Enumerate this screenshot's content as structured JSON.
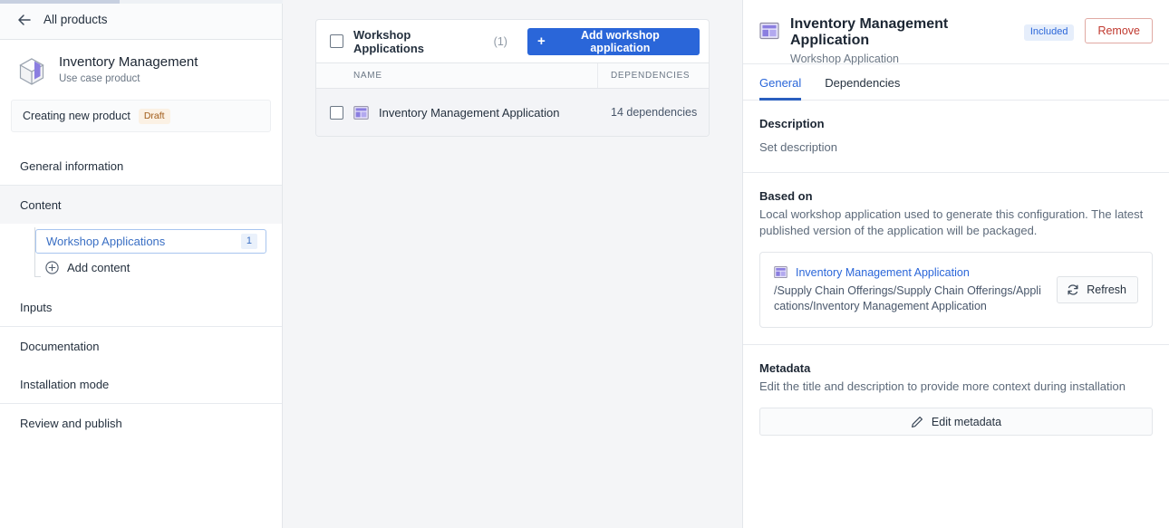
{
  "sidebar": {
    "back_label": "All products",
    "product_name": "Inventory Management",
    "product_subtitle": "Use case product",
    "status_text": "Creating new product",
    "status_badge": "Draft",
    "nav": [
      {
        "label": "General information"
      },
      {
        "label": "Content"
      },
      {
        "label": "Inputs"
      },
      {
        "label": "Documentation"
      },
      {
        "label": "Installation mode"
      },
      {
        "label": "Review and publish"
      }
    ],
    "content_children": {
      "selected_label": "Workshop Applications",
      "selected_count": "1",
      "add_label": "Add content"
    }
  },
  "center": {
    "card_title": "Workshop Applications",
    "card_count": "(1)",
    "add_button": "Add workshop application",
    "columns": [
      "NAME",
      "DEPENDENCIES"
    ],
    "rows": [
      {
        "name": "Inventory Management Application",
        "dependencies": "14 dependencies"
      }
    ]
  },
  "right": {
    "title": "Inventory Management Application",
    "badge": "Included",
    "subtitle": "Workshop Application",
    "remove_button": "Remove",
    "tabs": [
      {
        "label": "General",
        "active": true
      },
      {
        "label": "Dependencies",
        "active": false
      }
    ],
    "description": {
      "heading": "Description",
      "value": "Set description"
    },
    "based_on": {
      "heading": "Based on",
      "help": "Local workshop application used to generate this configuration. The latest published version of the application will be packaged.",
      "app_name": "Inventory Management Application",
      "path": "/Supply Chain Offerings/Supply Chain Offerings/Applications/Inventory Management Application",
      "refresh_button": "Refresh"
    },
    "metadata": {
      "heading": "Metadata",
      "help": "Edit the title and description to provide more context during installation",
      "edit_button": "Edit metadata"
    }
  },
  "colors": {
    "accent_blue": "#2a66d9",
    "danger_red": "#c0392f",
    "draft_amber": "#a05b18",
    "app_icon_purple": "#8b7ee0"
  }
}
